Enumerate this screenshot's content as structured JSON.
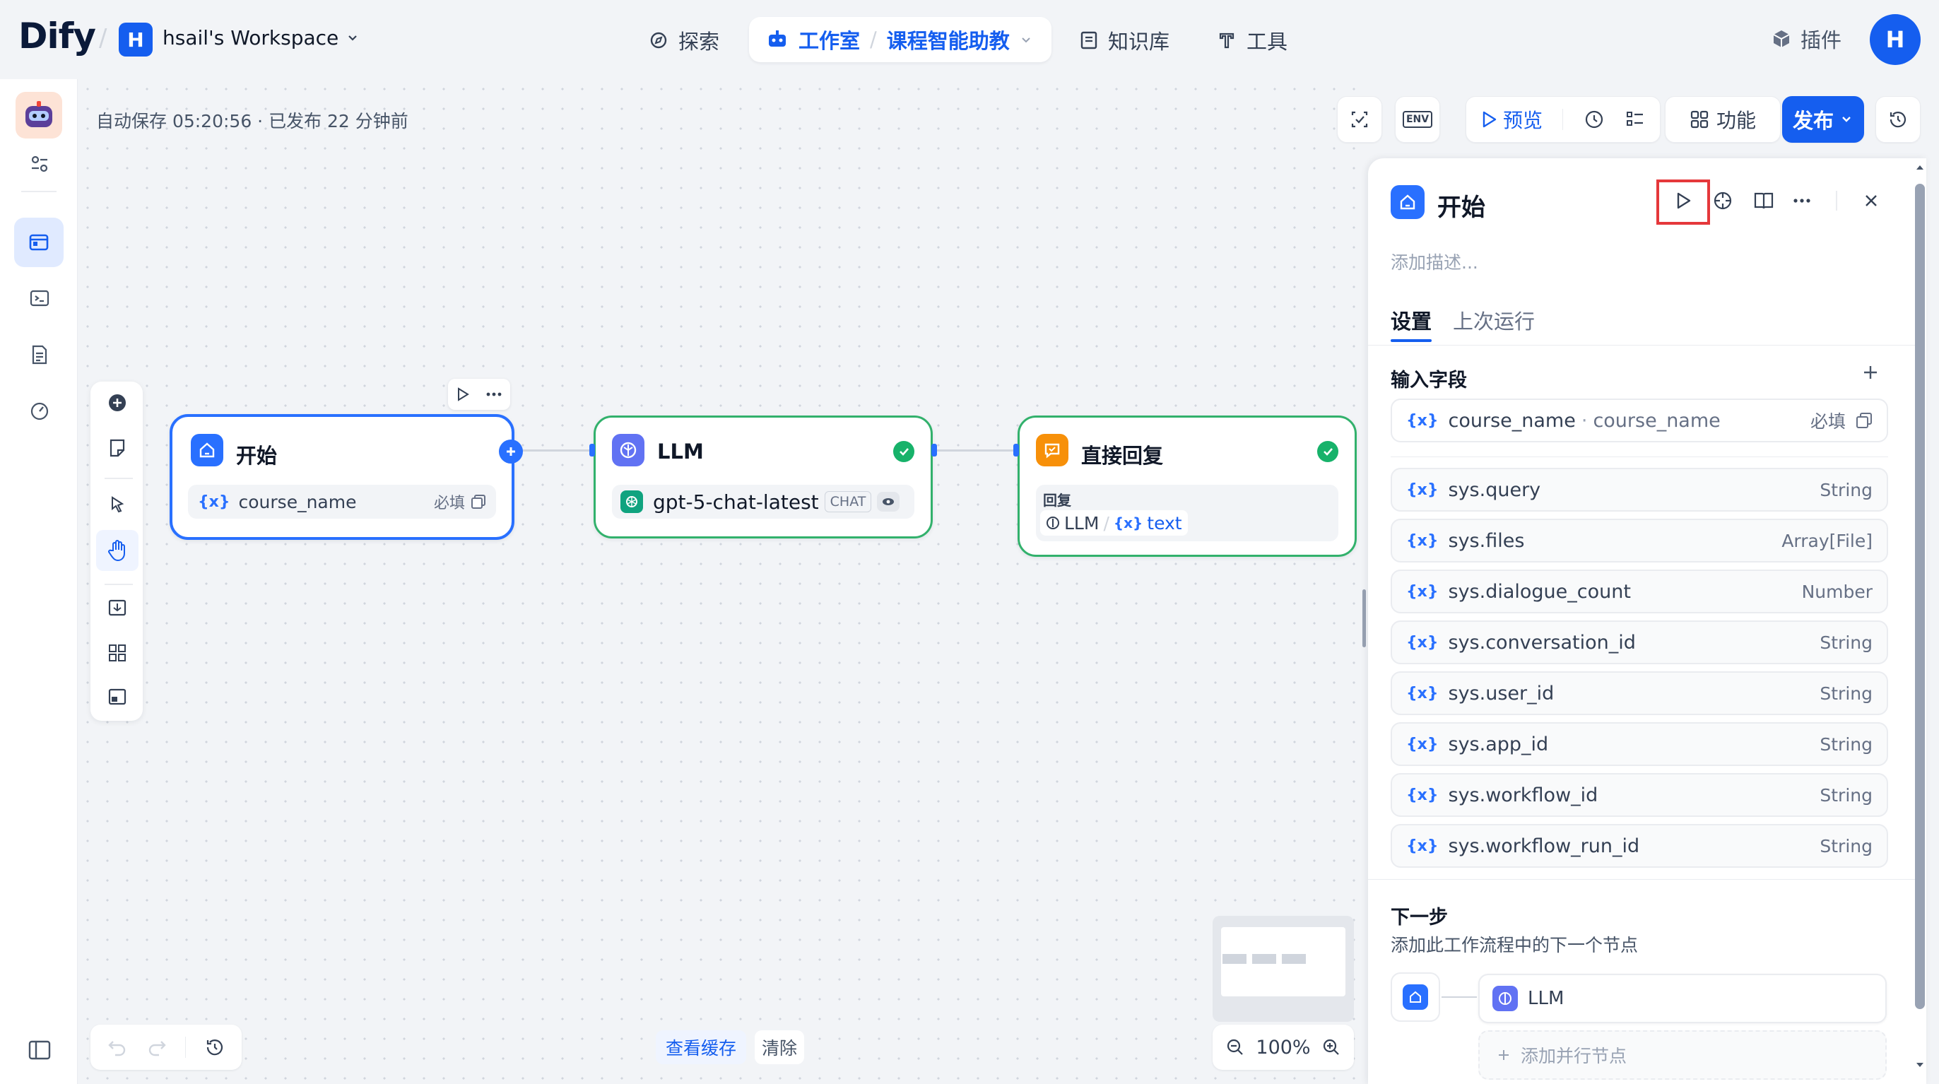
{
  "header": {
    "logo": "Dify",
    "workspace_initial": "H",
    "workspace_name": "hsail's Workspace",
    "nav": {
      "explore": "探索",
      "studio": "工作室",
      "app_name": "课程智能助教",
      "knowledge": "知识库",
      "tools": "工具"
    },
    "plugins": "插件",
    "avatar_initial": "H"
  },
  "canvas": {
    "autosave_status": "自动保存 05:20:56 · 已发布 22 分钟前"
  },
  "toolbar": {
    "env_label": "ENV",
    "preview": "预览",
    "features": "功能",
    "publish": "发布"
  },
  "nodes": {
    "start": {
      "title": "开始",
      "var_name": "course_name",
      "required": "必填"
    },
    "llm": {
      "title": "LLM",
      "model": "gpt-5-chat-latest",
      "mode": "CHAT"
    },
    "answer": {
      "title": "直接回复",
      "label": "回复",
      "ref_node": "LLM",
      "ref_var": "text"
    }
  },
  "panel": {
    "title": "开始",
    "description_placeholder": "添加描述...",
    "tabs": [
      "设置",
      "上次运行"
    ],
    "input_fields_title": "输入字段",
    "input_field": {
      "name": "course_name",
      "label": "course_name",
      "required": "必填"
    },
    "sys_vars": [
      {
        "name": "sys.query",
        "type": "String"
      },
      {
        "name": "sys.files",
        "type": "Array[File]"
      },
      {
        "name": "sys.dialogue_count",
        "type": "Number"
      },
      {
        "name": "sys.conversation_id",
        "type": "String"
      },
      {
        "name": "sys.user_id",
        "type": "String"
      },
      {
        "name": "sys.app_id",
        "type": "String"
      },
      {
        "name": "sys.workflow_id",
        "type": "String"
      },
      {
        "name": "sys.workflow_run_id",
        "type": "String"
      }
    ],
    "next_step_title": "下一步",
    "next_step_desc": "添加此工作流程中的下一个节点",
    "next_node": "LLM",
    "add_parallel": "添加并行节点"
  },
  "bottom": {
    "zoom": "100%",
    "view_cache": "查看缓存",
    "clear": "清除"
  },
  "colors": {
    "primary": "#155eef",
    "success": "#17b26a",
    "answer_orange": "#f79009",
    "llm_indigo": "#6172f3",
    "highlight_red": "#e5383b"
  }
}
